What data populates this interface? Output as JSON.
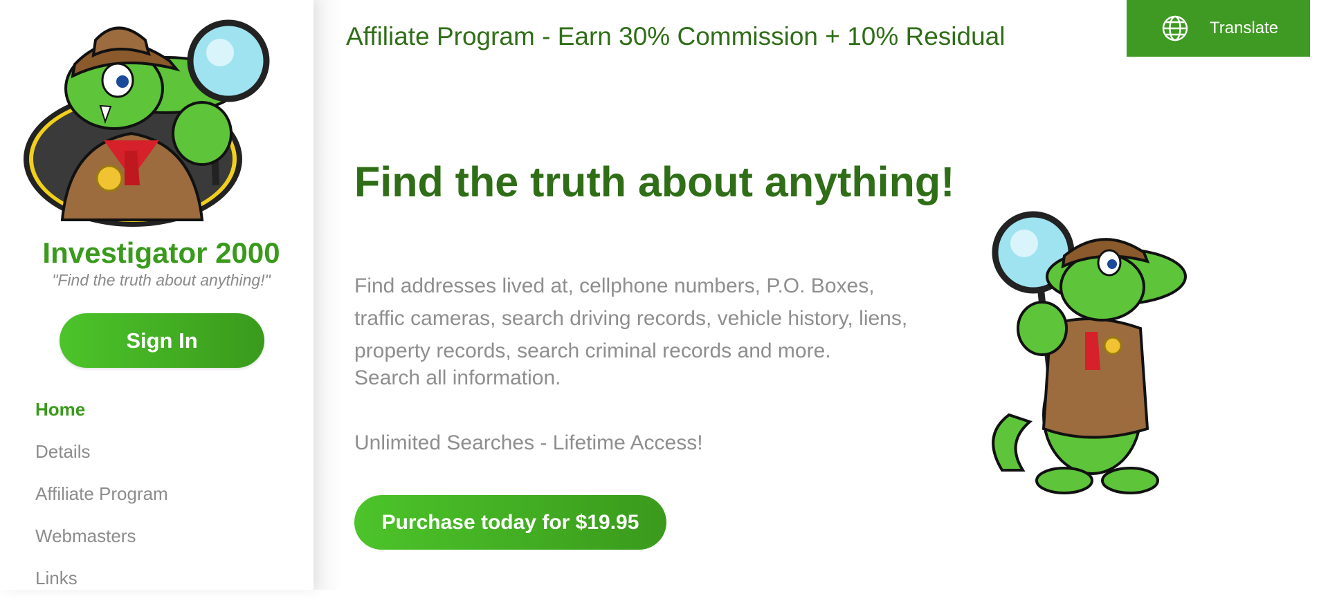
{
  "header": {
    "affiliate_text": "Affiliate Program - Earn 30% Commission + 10% Residual",
    "translate_label": "Translate"
  },
  "sidebar": {
    "site_title": "Investigator 2000",
    "tagline": "\"Find the truth about anything!\"",
    "signin_label": "Sign In",
    "nav": [
      {
        "label": "Home",
        "active": true
      },
      {
        "label": "Details"
      },
      {
        "label": "Affiliate Program"
      },
      {
        "label": "Webmasters"
      },
      {
        "label": "Links"
      }
    ]
  },
  "hero": {
    "heading": "Find the truth about anything!",
    "description": "Find addresses lived at, cellphone numbers, P.O. Boxes, traffic cameras, search driving records, vehicle history, liens, property records, search criminal records and more.",
    "search_all": "Search all information.",
    "unlimited": "Unlimited Searches - Lifetime Access!",
    "purchase_label": "Purchase today for $19.95"
  },
  "colors": {
    "brand_green": "#3a9a1c",
    "dark_green": "#2f6e17",
    "translate_bg": "#3e9a22",
    "body_gray": "#8e8e8e"
  },
  "icons": [
    "globe-icon",
    "gator-detective-logo",
    "gator-mascot-illustration"
  ]
}
